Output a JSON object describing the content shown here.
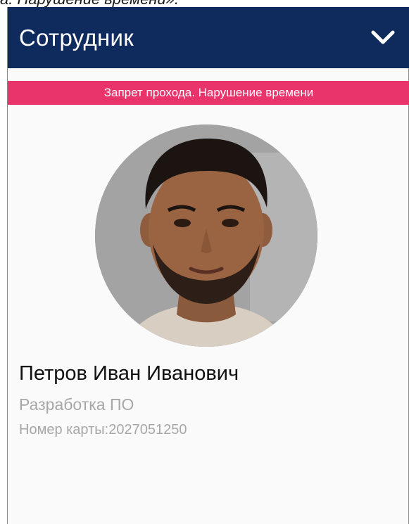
{
  "caption": {
    "text": "а. Нарушение времени»."
  },
  "appbar": {
    "title": "Сотрудник",
    "chevron_icon": "chevron-down-icon"
  },
  "alert": {
    "text": "Запрет прохода. Нарушение времени",
    "color": "#e8336b"
  },
  "employee": {
    "name": "Петров Иван Иванович",
    "department": "Разработка ПО",
    "card_number": "Номер карты:2027051250"
  },
  "colors": {
    "appbar": "#0f2a5c",
    "secondary_text": "#a7a7a7"
  }
}
